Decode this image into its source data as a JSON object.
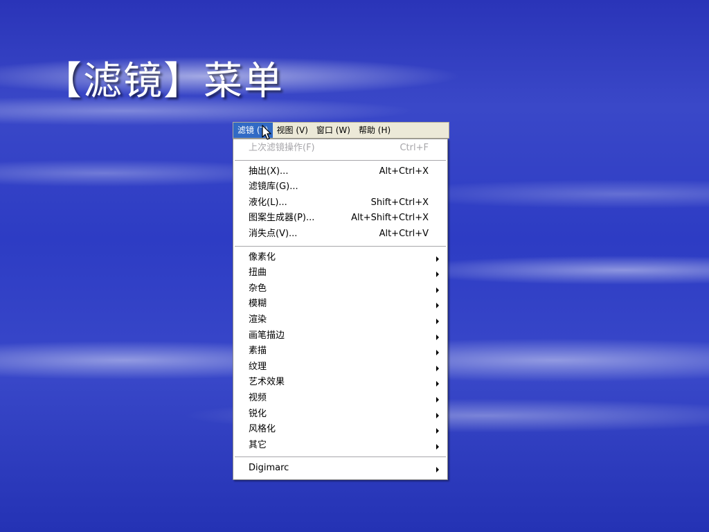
{
  "slide": {
    "title": "【滤镜】菜单"
  },
  "menubar": {
    "items": [
      {
        "label": "滤镜 (T)",
        "active": true
      },
      {
        "label": "视图 (V)",
        "active": false
      },
      {
        "label": "窗口 (W)",
        "active": false
      },
      {
        "label": "帮助 (H)",
        "active": false
      }
    ]
  },
  "filter_menu": {
    "last_filter": {
      "label": "上次滤镜操作(F)",
      "shortcut": "Ctrl+F",
      "disabled": true
    },
    "group1": [
      {
        "label": "抽出(X)...",
        "shortcut": "Alt+Ctrl+X"
      },
      {
        "label": "滤镜库(G)...",
        "shortcut": ""
      },
      {
        "label": "液化(L)...",
        "shortcut": "Shift+Ctrl+X"
      },
      {
        "label": "图案生成器(P)...",
        "shortcut": "Alt+Shift+Ctrl+X"
      },
      {
        "label": "消失点(V)...",
        "shortcut": "Alt+Ctrl+V"
      }
    ],
    "submenus": [
      "像素化",
      "扭曲",
      "杂色",
      "模糊",
      "渲染",
      "画笔描边",
      "素描",
      "纹理",
      "艺术效果",
      "视频",
      "锐化",
      "风格化",
      "其它"
    ],
    "digimarc": "Digimarc"
  },
  "colors": {
    "menu_highlight": "#316ac5",
    "menubar_bg": "#ece9d8",
    "disabled_text": "#a7a6aa"
  }
}
